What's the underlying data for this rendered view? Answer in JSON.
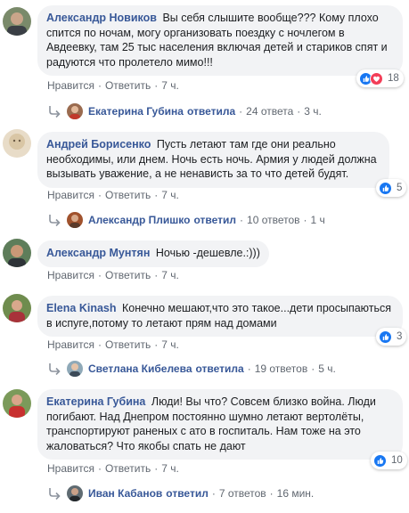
{
  "comments": [
    {
      "author": "Александр Новиков",
      "text": "Вы себя слышите вообще??? Кому плохо спится по ночам, могу организовать поездку с ночлегом в Авдеевку, там 25 тыс населения включая детей и стариков спят и радуются что пролетело мимо!!!",
      "like": "Нравится",
      "reply": "Ответить",
      "time": "7 ч.",
      "reactions": "18",
      "reply_author": "Екатерина Губина",
      "reply_verb": "ответила",
      "reply_count": "24 ответа",
      "reply_time": "3 ч."
    },
    {
      "author": "Андрей Борисенко",
      "text": "Пусть летают там где они реально необходимы, или днем. Ночь есть ночь. Армия у людей должна вызывать уважение, а не ненависть за то что детей будят.",
      "like": "Нравится",
      "reply": "Ответить",
      "time": "7 ч.",
      "reactions": "5",
      "reply_author": "Александр Плишко",
      "reply_verb": "ответил",
      "reply_count": "10 ответов",
      "reply_time": "1 ч"
    },
    {
      "author": "Александр Мунтян",
      "text": "Ночью -дешевле.:)))",
      "like": "Нравится",
      "reply": "Ответить",
      "time": "7 ч."
    },
    {
      "author": "Elena Kinash",
      "text": "Конечно мешают,что это такое...дети просыпаються в испуге,потому то летают прям над домами",
      "like": "Нравится",
      "reply": "Ответить",
      "time": "7 ч.",
      "reactions": "3",
      "reply_author": "Светлана Кибелева",
      "reply_verb": "ответила",
      "reply_count": "19 ответов",
      "reply_time": "5 ч."
    },
    {
      "author": "Екатерина Губина",
      "text": "Люди! Вы что? Совсем близко война. Люди погибают. Над Днепром постоянно шумно летают вертолёты, транспортируют раненых с ато в госпиталь. Нам тоже на это жаловаться? Что якобы спать не дают",
      "like": "Нравится",
      "reply": "Ответить",
      "time": "7 ч.",
      "reactions": "10",
      "reply_author": "Иван Кабанов",
      "reply_verb": "ответил",
      "reply_count": "7 ответов",
      "reply_time": "16 мин."
    }
  ],
  "separator": "·",
  "colors": {
    "link": "#385898",
    "bubble": "#f2f3f5",
    "meta": "#606770",
    "like": "#1877f2",
    "love": "#f33e58"
  },
  "icons": {
    "like": "thumbs-up-icon",
    "love": "heart-icon",
    "reply": "reply-arrow-icon"
  }
}
